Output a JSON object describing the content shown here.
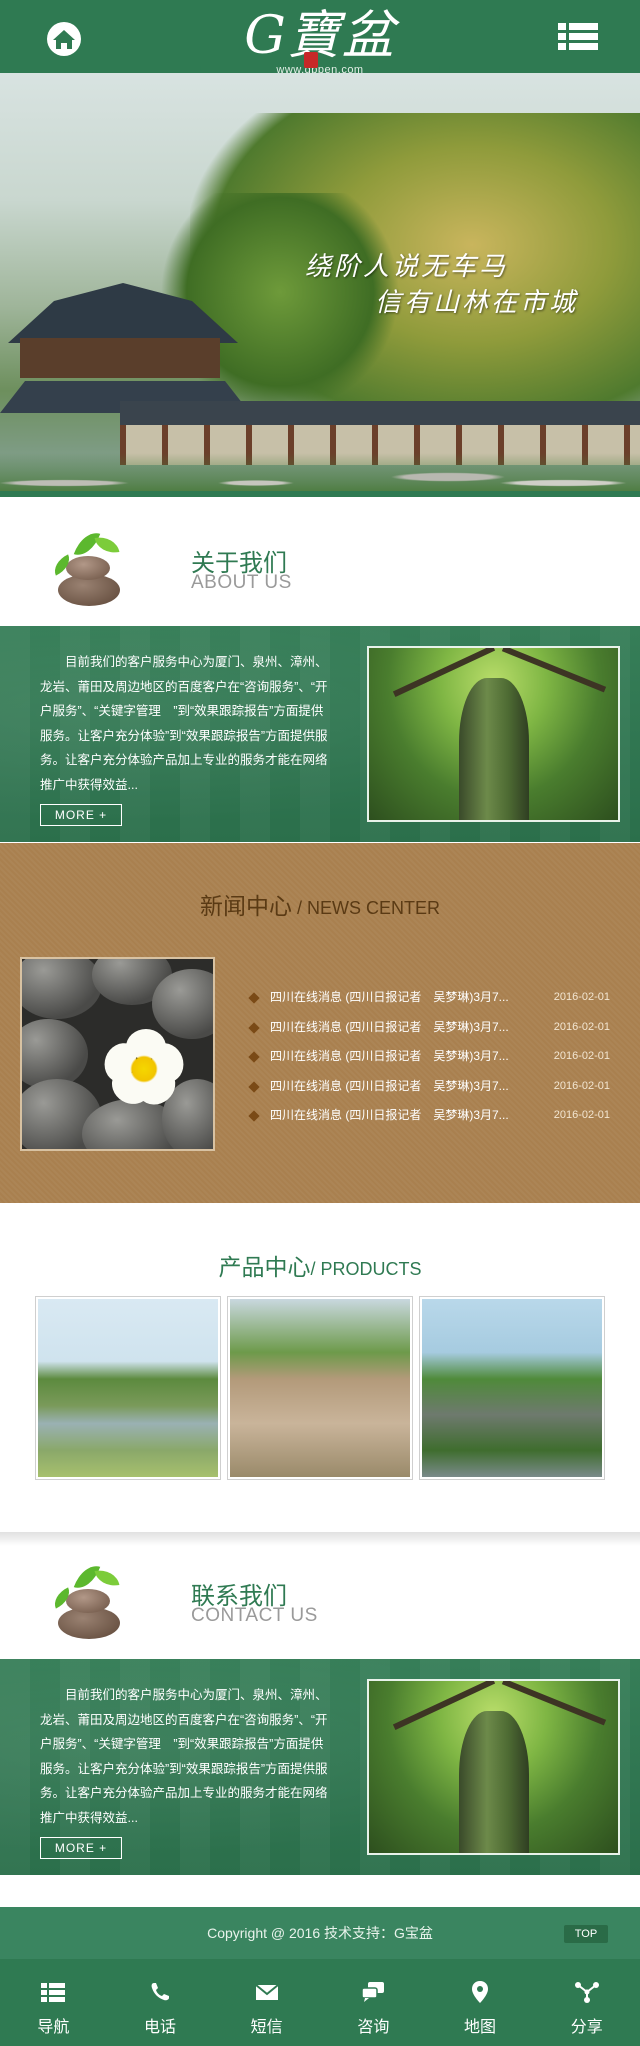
{
  "header": {
    "home_icon": "home-icon",
    "menu_icon": "list-menu-icon",
    "logo_text": "G寶盆",
    "logo_url": "www.gbpen.com",
    "color": "#2f7a52"
  },
  "banner": {
    "slogan_line1": "绕阶人说无车马",
    "slogan_line2": "信有山林在市城"
  },
  "about": {
    "title": "关于我们",
    "subtitle": "ABOUT US",
    "text": "目前我们的客户服务中心为厦门、泉州、漳州、龙岩、莆田及周边地区的百度客户在“咨询服务”、“开户服务”、“关键字管理　”到“效果跟踪报告”方面提供服务。让客户充分体验”到“效果跟踪报告”方面提供服务。让客户充分体验产品加上专业的服务才能在网络推广中获得效益...",
    "more_label": "MORE +"
  },
  "news": {
    "title_cn": "新闻中心",
    "title_sep": " / ",
    "title_en": "NEWS CENTER",
    "items": [
      {
        "title": "四川在线消息 (四川日报记者　吴梦琳)3月7...",
        "date": "2016-02-01"
      },
      {
        "title": "四川在线消息 (四川日报记者　吴梦琳)3月7...",
        "date": "2016-02-01"
      },
      {
        "title": "四川在线消息 (四川日报记者　吴梦琳)3月7...",
        "date": "2016-02-01"
      },
      {
        "title": "四川在线消息 (四川日报记者　吴梦琳)3月7...",
        "date": "2016-02-01"
      },
      {
        "title": "四川在线消息 (四川日报记者　吴梦琳)3月7...",
        "date": "2016-02-01"
      }
    ],
    "bg_color": "#a9804f"
  },
  "products": {
    "title_cn": "产品中心",
    "title_sep": "/ ",
    "title_en": "PRODUCTS"
  },
  "contact": {
    "title": "联系我们",
    "subtitle": "CONTACT US",
    "text": "目前我们的客户服务中心为厦门、泉州、漳州、龙岩、莆田及周边地区的百度客户在“咨询服务”、“开户服务”、“关键字管理　”到“效果跟踪报告”方面提供服务。让客户充分体验”到“效果跟踪报告”方面提供服务。让客户充分体验产品加上专业的服务才能在网络推广中获得效益...",
    "more_label": "MORE +"
  },
  "footer": {
    "copyright": "Copyright @ 2016 技术支持：G宝盆",
    "top_label": "TOP"
  },
  "bottom_nav": [
    {
      "label": "导航",
      "icon": "list-icon"
    },
    {
      "label": "电话",
      "icon": "phone-icon"
    },
    {
      "label": "短信",
      "icon": "envelope-icon"
    },
    {
      "label": "咨询",
      "icon": "chat-icon"
    },
    {
      "label": "地图",
      "icon": "map-pin-icon"
    },
    {
      "label": "分享",
      "icon": "share-icon"
    }
  ]
}
